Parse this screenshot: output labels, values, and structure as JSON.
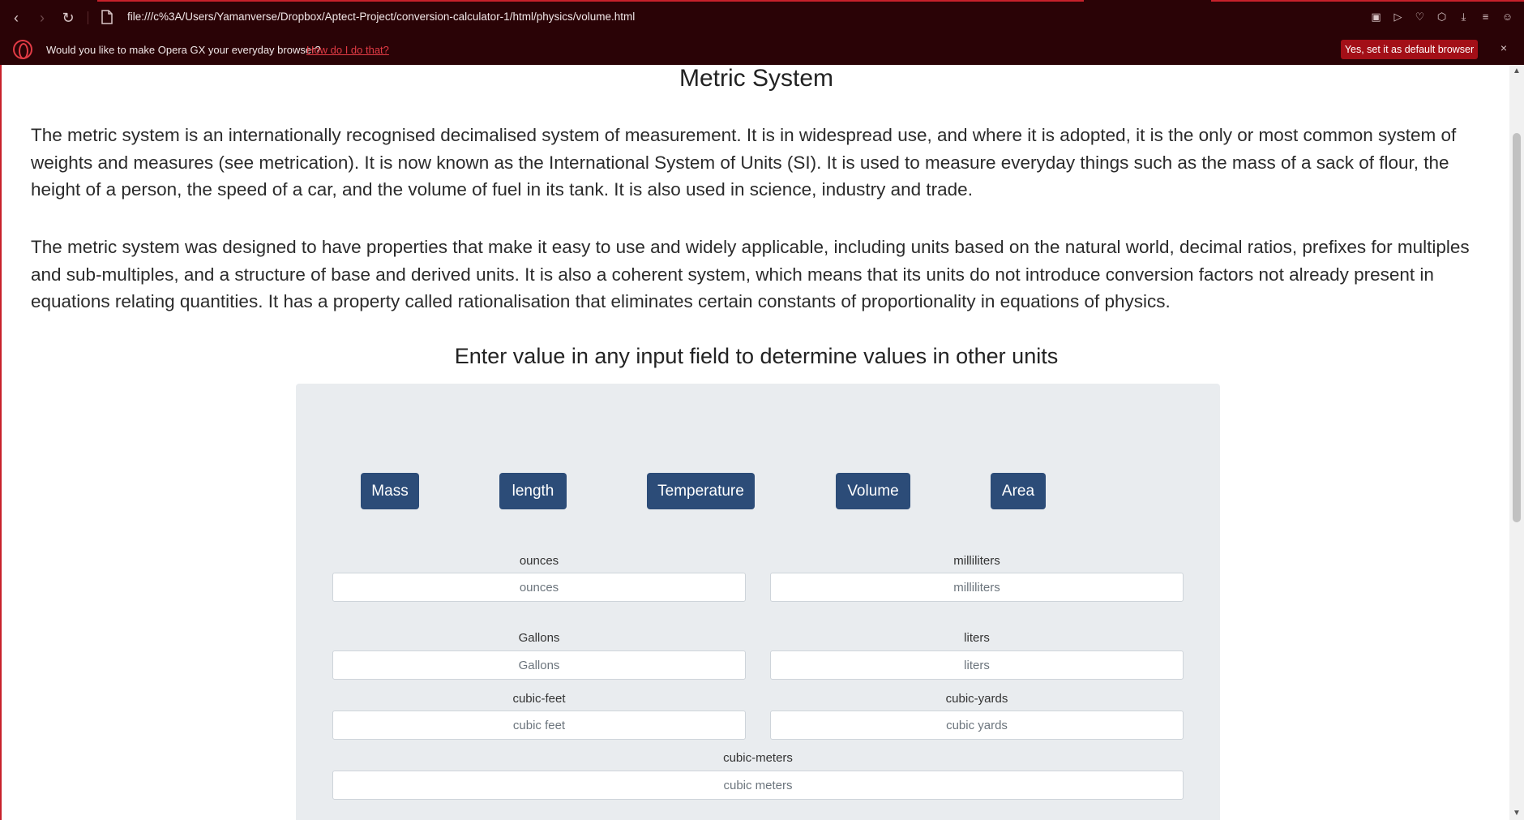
{
  "browser": {
    "url": "file:///c%3A/Users/Yamanverse/Dropbox/Aptect-Project/conversion-calculator-1/html/physics/volume.html",
    "notice_text": "Would you like to make Opera GX your everyday browser?",
    "notice_link": "How do I do that?",
    "default_button": "Yes, set it as default browser",
    "close_label": "×",
    "accent_color": "#c8212b"
  },
  "page": {
    "heading": "Metric System",
    "paragraph1": "The metric system is an internationally recognised decimalised system of measurement. It is in widespread use, and where it is adopted, it is the only or most common system of weights and measures (see metrication). It is now known as the International System of Units (SI). It is used to measure everyday things such as the mass of a sack of flour, the height of a person, the speed of a car, and the volume of fuel in its tank. It is also used in science, industry and trade.",
    "paragraph2": "The metric system was designed to have properties that make it easy to use and widely applicable, including units based on the natural world, decimal ratios, prefixes for multiples and sub-multiples, and a structure of base and derived units. It is also a coherent system, which means that its units do not introduce conversion factors not already present in equations relating quantities. It has a property called rationalisation that eliminates certain constants of proportionality in equations of physics.",
    "subheading": "Enter value in any input field to determine values in other units"
  },
  "categories": [
    "Mass",
    "length",
    "Temperature",
    "Volume",
    "Area"
  ],
  "fields": {
    "ounces": {
      "label": "ounces",
      "placeholder": "ounces"
    },
    "milliliters": {
      "label": "milliliters",
      "placeholder": "milliliters"
    },
    "gallons": {
      "label": "Gallons",
      "placeholder": "Gallons"
    },
    "liters": {
      "label": "liters",
      "placeholder": "liters"
    },
    "cubic_feet": {
      "label": "cubic-feet",
      "placeholder": "cubic feet"
    },
    "cubic_yards": {
      "label": "cubic-yards",
      "placeholder": "cubic yards"
    },
    "cubic_meters": {
      "label": "cubic-meters",
      "placeholder": "cubic meters"
    }
  }
}
